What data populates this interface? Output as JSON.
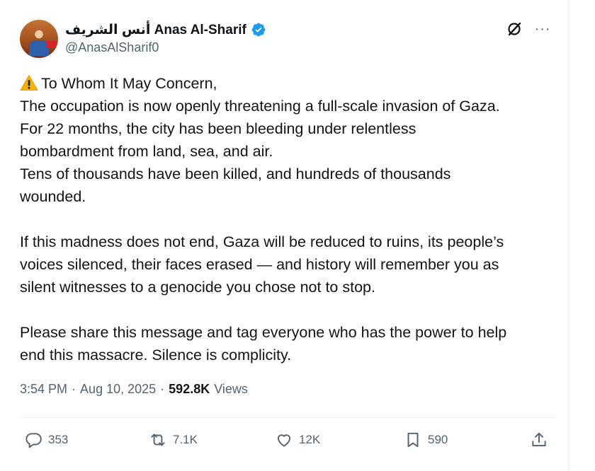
{
  "author": {
    "display_name": "أنس الشريف Anas Al-Sharif",
    "handle": "@AnasAlSharif0",
    "verified_icon": "verified-badge-icon",
    "brand_color": "#1d9bf0"
  },
  "tweet": {
    "lines": [
      "To Whom It May Concern,",
      "The occupation is now openly threatening a full-scale invasion of Gaza.",
      "For 22 months, the city has been bleeding under relentless",
      "bombardment from land, sea, and air.",
      "Tens of thousands have been killed, and hundreds of thousands",
      "wounded.",
      "If this madness does not end, Gaza will be reduced to ruins, its people’s",
      "voices silenced, their faces erased — and history will remember you as",
      "silent witnesses to a genocide you chose not to stop.",
      "Please share this message and tag everyone who has the power to help",
      "end this massacre. Silence is complicity."
    ]
  },
  "meta": {
    "time": "3:54 PM",
    "sep1": "·",
    "date": "Aug 10, 2025",
    "sep2": "·",
    "views_count": "592.8K",
    "views_label": "Views"
  },
  "actions": {
    "replies": "353",
    "reposts": "7.1K",
    "likes": "12K",
    "bookmarks": "590"
  },
  "colors": {
    "text": "#0f1419",
    "secondary": "#536471",
    "divider": "#eff3f4"
  }
}
